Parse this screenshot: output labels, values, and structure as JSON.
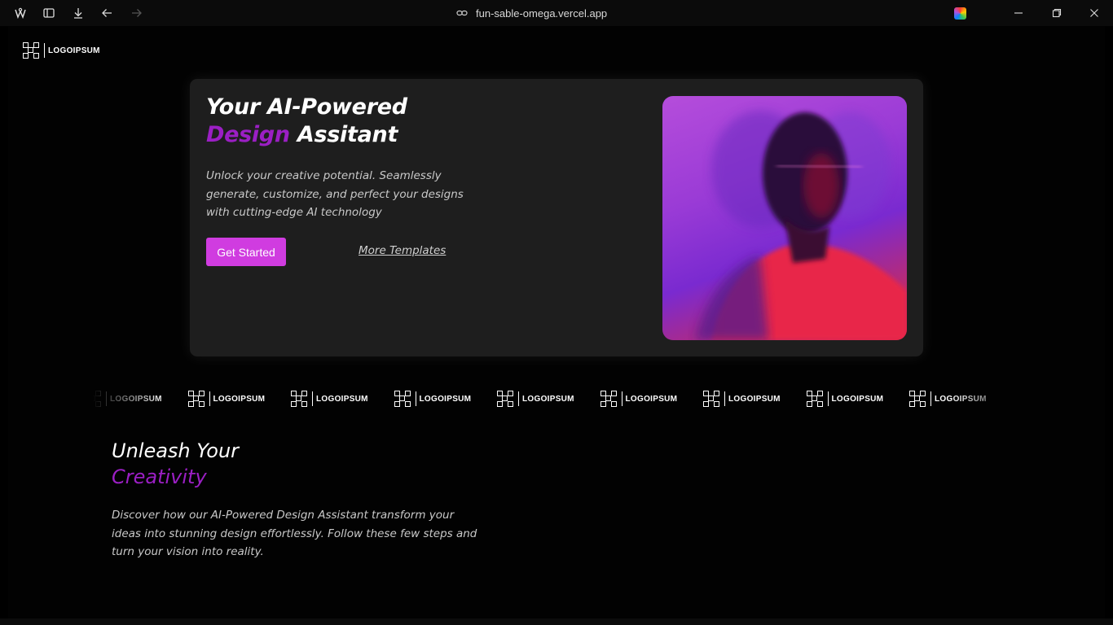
{
  "browser": {
    "url": "fun-sable-omega.vercel.app",
    "icons": [
      "app-icon",
      "sidebar-icon",
      "download-icon",
      "back-icon",
      "forward-icon",
      "link-icon",
      "extension-icon",
      "minimize-icon",
      "restore-icon",
      "close-icon"
    ]
  },
  "header": {
    "logo_text": "LOGOIPSUM"
  },
  "hero": {
    "title_line1": "Your AI-Powered",
    "title_accent": "Design",
    "title_rest": " Assitant",
    "description": "Unlock your creative potential. Seamlessly generate, customize, and perfect your designs with cutting-edge AI technology",
    "primary_button": "Get Started",
    "secondary_link": "More Templates"
  },
  "logo_strip": {
    "items": [
      "LOGOIPSUM",
      "LOGOIPSUM",
      "LOGOIPSUM",
      "LOGOIPSUM",
      "LOGOIPSUM",
      "LOGOIPSUM",
      "LOGOIPSUM",
      "LOGOIPSUM",
      "LOGOIPSUM"
    ]
  },
  "section2": {
    "title_line1": "Unleash Your",
    "title_accent": "Creativity",
    "description": "Discover how our AI-Powered Design Assistant transform your ideas into stunning design effortlessly. Follow these few steps and turn your vision into reality."
  },
  "colors": {
    "accent": "#9b1fc4",
    "button": "#d03ce0",
    "card": "#1e1e1e",
    "background": "#020202"
  }
}
